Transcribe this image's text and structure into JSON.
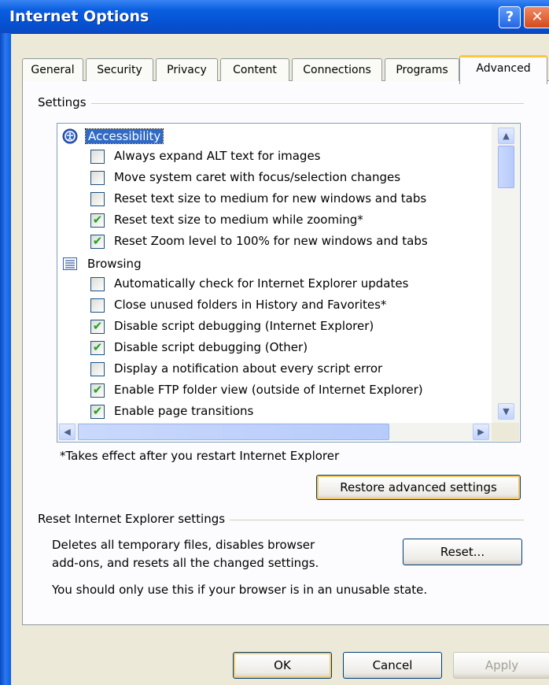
{
  "window": {
    "title": "Internet Options"
  },
  "tabs": [
    {
      "label": "General"
    },
    {
      "label": "Security"
    },
    {
      "label": "Privacy"
    },
    {
      "label": "Content"
    },
    {
      "label": "Connections"
    },
    {
      "label": "Programs"
    },
    {
      "label": "Advanced",
      "active": true
    }
  ],
  "settings": {
    "group_label": "Settings",
    "categories": [
      {
        "label": "Accessibility",
        "icon": "accessibility-icon",
        "selected": true,
        "options": [
          {
            "label": "Always expand ALT text for images",
            "checked": false
          },
          {
            "label": "Move system caret with focus/selection changes",
            "checked": false
          },
          {
            "label": "Reset text size to medium for new windows and tabs",
            "checked": false
          },
          {
            "label": "Reset text size to medium while zooming*",
            "checked": true
          },
          {
            "label": "Reset Zoom level to 100% for new windows and tabs",
            "checked": true
          }
        ]
      },
      {
        "label": "Browsing",
        "icon": "browsing-icon",
        "options": [
          {
            "label": "Automatically check for Internet Explorer updates",
            "checked": false
          },
          {
            "label": "Close unused folders in History and Favorites*",
            "checked": false
          },
          {
            "label": "Disable script debugging (Internet Explorer)",
            "checked": true
          },
          {
            "label": "Disable script debugging (Other)",
            "checked": true
          },
          {
            "label": "Display a notification about every script error",
            "checked": false
          },
          {
            "label": "Enable FTP folder view (outside of Internet Explorer)",
            "checked": true
          },
          {
            "label": "Enable page transitions",
            "checked": true
          }
        ]
      }
    ],
    "restart_note": "*Takes effect after you restart Internet Explorer",
    "restore_button": "Restore advanced settings"
  },
  "reset": {
    "group_label": "Reset Internet Explorer settings",
    "description_line1": "Deletes all temporary files, disables browser",
    "description_line2": "add-ons, and resets all the changed settings.",
    "warning": "You should only use this if your browser is in an unusable state.",
    "reset_button": "Reset..."
  },
  "footer": {
    "ok": "OK",
    "cancel": "Cancel",
    "apply": "Apply"
  },
  "colors": {
    "selection": "#316ac5",
    "check": "#21a121",
    "titlebar": "#0552d3"
  }
}
